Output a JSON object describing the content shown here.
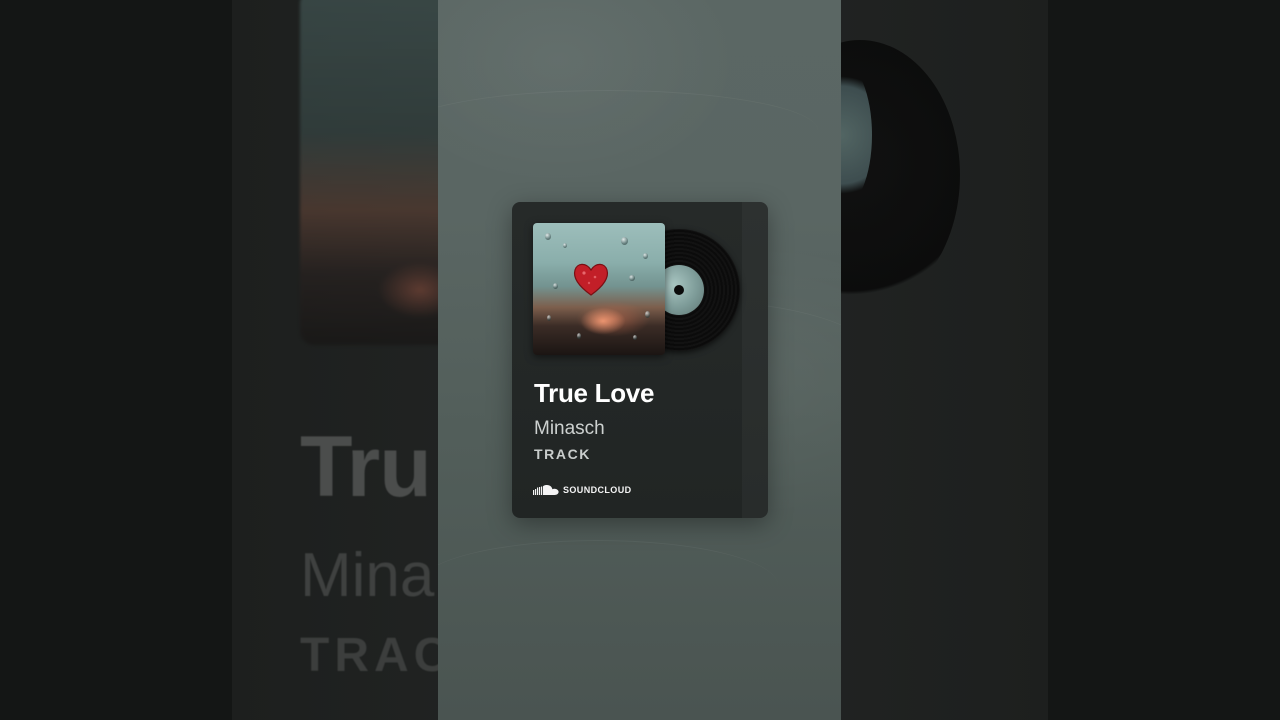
{
  "track": {
    "title": "True Love",
    "artist": "Minasch",
    "type": "TRACK"
  },
  "source": {
    "label": "SOUNDCLOUD",
    "icon": "soundcloud-icon"
  },
  "background": {
    "title": "Tru",
    "artist": "Mina",
    "type": "TRAC"
  },
  "colors": {
    "card": "#222625",
    "panel": "#58635f",
    "backdrop": "#141615",
    "heart": "#c21f28"
  }
}
